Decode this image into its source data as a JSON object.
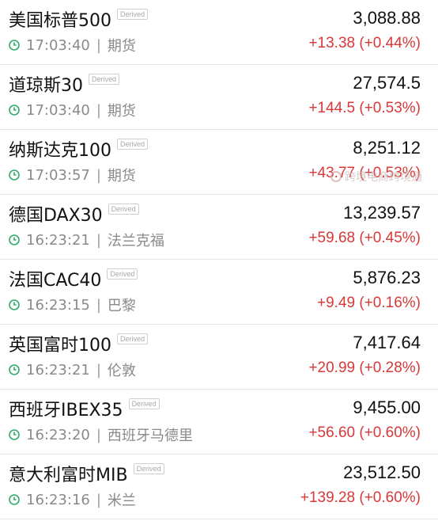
{
  "colors": {
    "up": "#d93838",
    "text": "#111111",
    "muted": "#8a8a8a",
    "clock": "#2faa6a"
  },
  "rows": [
    {
      "name": "美国标普500",
      "badge": "Derived",
      "time": "17:03:40",
      "market": "期货",
      "price": "3,088.88",
      "change": "+13.38 (+0.44%)"
    },
    {
      "name": "道琼斯30",
      "badge": "Derived",
      "time": "17:03:40",
      "market": "期货",
      "price": "27,574.5",
      "change": "+144.5 (+0.53%)"
    },
    {
      "name": "纳斯达克100",
      "badge": "Derived",
      "time": "17:03:57",
      "market": "期货",
      "price": "8,251.12",
      "change": "+43.77 (+0.53%)"
    },
    {
      "name": "德国DAX30",
      "badge": "Derived",
      "time": "16:23:21",
      "market": "法兰克福",
      "price": "13,239.57",
      "change": "+59.68 (+0.45%)"
    },
    {
      "name": "法国CAC40",
      "badge": "Derived",
      "time": "16:23:15",
      "market": "巴黎",
      "price": "5,876.23",
      "change": "+9.49 (+0.16%)"
    },
    {
      "name": "英国富时100",
      "badge": "Derived",
      "time": "16:23:21",
      "market": "伦敦",
      "price": "7,417.64",
      "change": "+20.99 (+0.28%)"
    },
    {
      "name": "西班牙IBEX35",
      "badge": "Derived",
      "time": "16:23:20",
      "market": "西班牙马德里",
      "price": "9,455.00",
      "change": "+56.60 (+0.60%)"
    },
    {
      "name": "意大利富时MIB",
      "badge": "Derived",
      "time": "16:23:16",
      "market": "米兰",
      "price": "23,512.50",
      "change": "+139.28 (+0.60%)"
    }
  ],
  "watermark": {
    "text": "跨境电商跨境通"
  }
}
